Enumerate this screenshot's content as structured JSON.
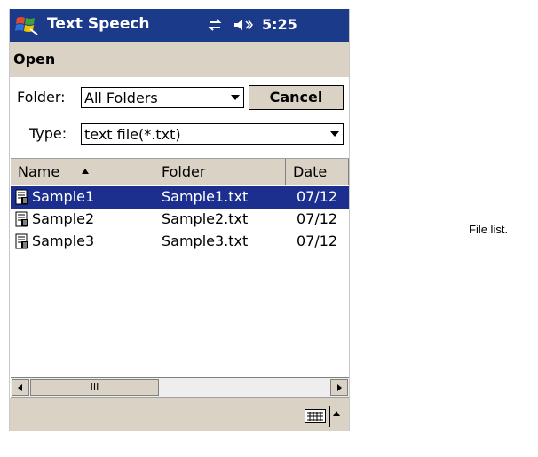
{
  "titlebar": {
    "app_title": "Text Speech",
    "clock": "5:25"
  },
  "dialog": {
    "title": "Open",
    "folder_label": "Folder:",
    "folder_value": "All Folders",
    "cancel_label": "Cancel",
    "type_label": "Type:",
    "type_value": "text file(*.txt)"
  },
  "list": {
    "columns": [
      "Name",
      "Folder",
      "Date"
    ],
    "rows": [
      {
        "name": "Sample1",
        "folder": "Sample1.txt",
        "date": "07/12",
        "selected": true
      },
      {
        "name": "Sample2",
        "folder": "Sample2.txt",
        "date": "07/12",
        "selected": false
      },
      {
        "name": "Sample3",
        "folder": "Sample3.txt",
        "date": "07/12",
        "selected": false
      }
    ],
    "scroll_thumb_label": "III"
  },
  "callout": {
    "label": "File list."
  },
  "colors": {
    "titlebar": "#1c3a8a",
    "selection": "#1c2f8f",
    "chrome": "#d9d2c5"
  }
}
